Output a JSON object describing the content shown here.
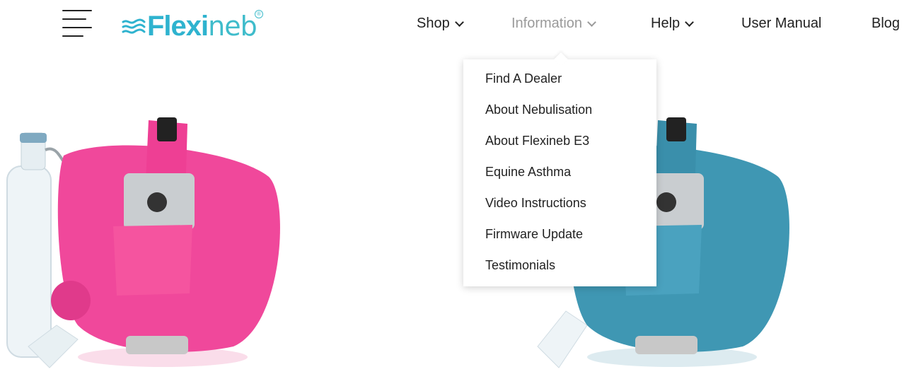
{
  "header": {
    "logo_text_bold": "Flexi",
    "logo_text_thin": "neb",
    "logo_registered": "®"
  },
  "nav": {
    "items": [
      {
        "label": "Shop",
        "has_dropdown": true
      },
      {
        "label": "Information",
        "has_dropdown": true,
        "state": "hovered"
      },
      {
        "label": "Help",
        "has_dropdown": true
      },
      {
        "label": "User Manual",
        "has_dropdown": false
      },
      {
        "label": "Blog",
        "has_dropdown": false
      }
    ]
  },
  "dropdown": {
    "items": [
      "Find A Dealer",
      "About Nebulisation",
      "About Flexineb E3",
      "Equine Asthma",
      "Video Instructions",
      "Firmware Update",
      "Testimonials"
    ]
  },
  "colors": {
    "brand": "#2fb3cf",
    "nav_text": "#222222",
    "nav_muted": "#9a9a9a",
    "pink_product": "#f0489b",
    "blue_product": "#3f97b3"
  },
  "icons": [
    "menu-icon",
    "chevron-down-icon"
  ]
}
